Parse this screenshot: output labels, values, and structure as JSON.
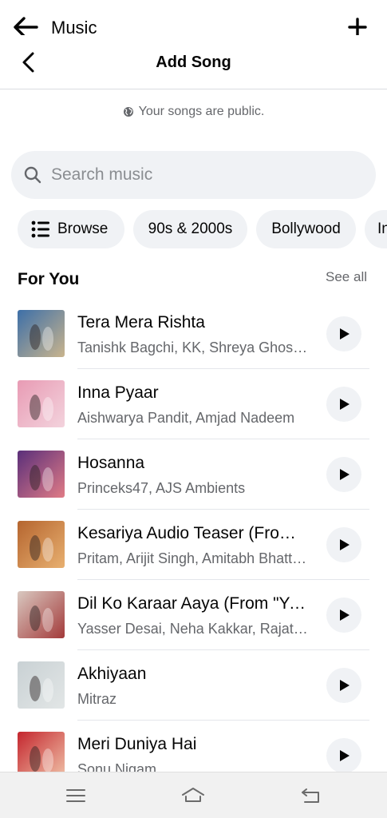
{
  "app_bar": {
    "title": "Music",
    "back_icon": "arrow-left-icon",
    "add_icon": "plus-icon"
  },
  "header": {
    "title": "Add Song",
    "back_icon": "chevron-left-icon"
  },
  "privacy": {
    "text": "Your songs are public.",
    "icon": "globe-icon"
  },
  "search": {
    "placeholder": "Search music",
    "value": "",
    "icon": "search-icon"
  },
  "chips": [
    {
      "label": "Browse",
      "icon": "list-icon"
    },
    {
      "label": "90s & 2000s"
    },
    {
      "label": "Bollywood"
    },
    {
      "label": "In"
    }
  ],
  "section": {
    "title": "For You",
    "see_all": "See all"
  },
  "songs": [
    {
      "title": "Tera Mera Rishta",
      "artist": "Tanishk Bagchi, KK, Shreya Ghoshal",
      "art_colors": [
        "#3d6fa8",
        "#c9b48d"
      ]
    },
    {
      "title": "Inna Pyaar",
      "artist": "Aishwarya Pandit, Amjad Nadeem",
      "art_colors": [
        "#e89bb4",
        "#f3d3dd"
      ]
    },
    {
      "title": "Hosanna",
      "artist": "Princeks47, AJS Ambients",
      "art_colors": [
        "#5a2f7a",
        "#e07b86"
      ]
    },
    {
      "title": "Kesariya Audio Teaser (From \"Brahmastra\")",
      "artist": "Pritam, Arijit Singh, Amitabh Bhattacharya",
      "art_colors": [
        "#b5652f",
        "#e8b070"
      ]
    },
    {
      "title": "Dil Ko Karaar Aaya (From \"Yaar Mera Teri\")",
      "artist": "Yasser Desai, Neha Kakkar, Rajat Nagpal",
      "art_colors": [
        "#d9c8c0",
        "#a33a3a"
      ]
    },
    {
      "title": "Akhiyaan",
      "artist": "Mitraz",
      "art_colors": [
        "#c9d1d4",
        "#e2e6e6"
      ]
    },
    {
      "title": "Meri Duniya Hai",
      "artist": "Sonu Nigam",
      "art_colors": [
        "#c4262e",
        "#f0c2a8"
      ]
    }
  ],
  "nav": {
    "menu_icon": "menu-icon",
    "home_icon": "home-icon",
    "back_icon": "back-icon"
  },
  "colors": {
    "chip_bg": "#f0f2f5",
    "secondary_text": "#65676b",
    "primary_text": "#050505"
  }
}
